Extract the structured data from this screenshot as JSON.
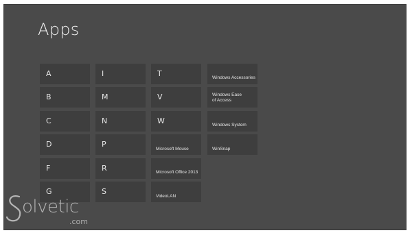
{
  "page": {
    "title": "Apps"
  },
  "columns": [
    {
      "tiles": [
        {
          "label": "A"
        },
        {
          "label": "B"
        },
        {
          "label": "C"
        },
        {
          "label": "D"
        },
        {
          "label": "F"
        },
        {
          "label": "G"
        }
      ]
    },
    {
      "tiles": [
        {
          "label": "I"
        },
        {
          "label": "M"
        },
        {
          "label": "N"
        },
        {
          "label": "P"
        },
        {
          "label": "R"
        },
        {
          "label": "S"
        }
      ]
    },
    {
      "tiles": [
        {
          "label": "T"
        },
        {
          "label": "V"
        },
        {
          "label": "W"
        },
        {
          "label": "Microsoft Mouse"
        },
        {
          "label": "Microsoft Office 2013"
        },
        {
          "label": "VideoLAN"
        }
      ]
    },
    {
      "tiles": [
        {
          "label": "Windows Accessories"
        },
        {
          "label": "Windows Ease of Access"
        },
        {
          "label": "Windows System"
        },
        {
          "label": "WinSnap"
        }
      ]
    }
  ],
  "watermark": {
    "brand": "olvetic",
    "suffix": ".com"
  }
}
